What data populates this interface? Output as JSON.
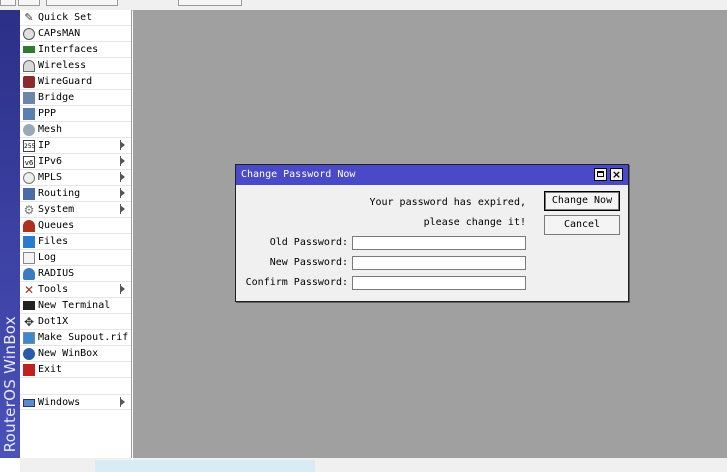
{
  "brand": {
    "text": "RouterOS WinBox"
  },
  "menu": {
    "items": [
      {
        "label": "Quick Set",
        "icon": "wand-icon",
        "submenu": false
      },
      {
        "label": "CAPsMAN",
        "icon": "capsman-icon",
        "submenu": false
      },
      {
        "label": "Interfaces",
        "icon": "interfaces-icon",
        "submenu": false
      },
      {
        "label": "Wireless",
        "icon": "wireless-icon",
        "submenu": false
      },
      {
        "label": "WireGuard",
        "icon": "wireguard-icon",
        "submenu": false
      },
      {
        "label": "Bridge",
        "icon": "bridge-icon",
        "submenu": false
      },
      {
        "label": "PPP",
        "icon": "ppp-icon",
        "submenu": false
      },
      {
        "label": "Mesh",
        "icon": "mesh-icon",
        "submenu": false
      },
      {
        "label": "IP",
        "icon": "ip-icon",
        "submenu": true,
        "icon_text": "255"
      },
      {
        "label": "IPv6",
        "icon": "ipv6-icon",
        "submenu": true,
        "icon_text": "v6"
      },
      {
        "label": "MPLS",
        "icon": "mpls-icon",
        "submenu": true
      },
      {
        "label": "Routing",
        "icon": "routing-icon",
        "submenu": true
      },
      {
        "label": "System",
        "icon": "gear-icon",
        "submenu": true
      },
      {
        "label": "Queues",
        "icon": "queues-icon",
        "submenu": false
      },
      {
        "label": "Files",
        "icon": "folder-icon",
        "submenu": false
      },
      {
        "label": "Log",
        "icon": "log-icon",
        "submenu": false
      },
      {
        "label": "RADIUS",
        "icon": "users-icon",
        "submenu": false
      },
      {
        "label": "Tools",
        "icon": "tools-icon",
        "submenu": true
      },
      {
        "label": "New Terminal",
        "icon": "terminal-icon",
        "submenu": false
      },
      {
        "label": "Dot1X",
        "icon": "dot1x-icon",
        "submenu": false
      },
      {
        "label": "Make Supout.rif",
        "icon": "supout-icon",
        "submenu": false
      },
      {
        "label": "New WinBox",
        "icon": "winbox-icon",
        "submenu": false
      },
      {
        "label": "Exit",
        "icon": "exit-icon",
        "submenu": false
      },
      {
        "label": "Windows",
        "icon": "windows-icon",
        "submenu": true
      }
    ]
  },
  "dialog": {
    "title": "Change Password Now",
    "message_line1": "Your password has expired,",
    "message_line2": "please change it!",
    "old_password_label": "Old Password:",
    "new_password_label": "New Password:",
    "confirm_password_label": "Confirm Password:",
    "old_password_value": "",
    "new_password_value": "",
    "confirm_password_value": "",
    "change_now_label": "Change Now",
    "cancel_label": "Cancel",
    "close_glyph": "×"
  }
}
